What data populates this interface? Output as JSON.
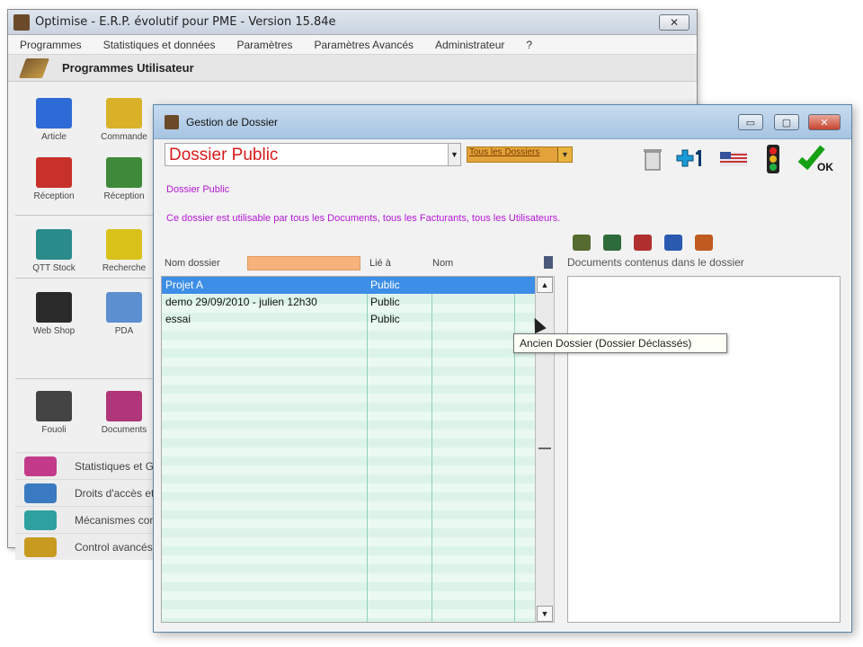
{
  "main_window": {
    "title": "Optimise  -  E.R.P. évolutif pour PME   -  Version 15.84e",
    "menu": [
      "Programmes",
      "Statistiques et données",
      "Paramètres",
      "Paramètres Avancés",
      "Administrateur",
      "?"
    ],
    "section_header": "Programmes Utilisateur",
    "tiles": [
      {
        "label": "Article",
        "color": "#2f6bd6"
      },
      {
        "label": "Commande",
        "color": "#d9b22a"
      },
      {
        "label": "Réception",
        "color": "#c8302a"
      },
      {
        "label": "Réception",
        "color": "#3f8a3a"
      },
      {
        "label": "QTT Stock",
        "color": "#2a8b8b"
      },
      {
        "label": "Recherche",
        "color": "#d8c21a"
      },
      {
        "label": "Web Shop",
        "color": "#2a2a2a"
      },
      {
        "label": "PDA",
        "color": "#5c8fd0"
      },
      {
        "label": "Fouoli",
        "color": "#444444"
      },
      {
        "label": "Documents",
        "color": "#b0367a"
      }
    ],
    "bottom_list": [
      {
        "label": "Statistiques et G",
        "color": "#c43a8a"
      },
      {
        "label": "Droits d'accès et",
        "color": "#3a7ac0"
      },
      {
        "label": "Mécanismes con",
        "color": "#2fa0a0"
      },
      {
        "label": "Control avancés",
        "color": "#c89a20"
      }
    ]
  },
  "dialog": {
    "title": "Gestion de Dossier",
    "buttons": {
      "minimize": "▭",
      "maximize": "▢",
      "close": "✕",
      "ok": "OK"
    },
    "dossier_select": "Dossier Public",
    "all_dossiers_select": "Tous les Dossiers",
    "info_name": "Dossier Public",
    "info_desc": "Ce dossier est utilisable par tous les Documents,  tous les Facturants, tous les Utilisateurs.",
    "columns": {
      "name": "Nom dossier",
      "linked": "Lié à",
      "nom": "Nom"
    },
    "docs_label": "Documents contenus dans le dossier",
    "rows": [
      {
        "name": "Projet A",
        "linked": "Public",
        "selected": true
      },
      {
        "name": "demo 29/09/2010 - julien 12h30",
        "linked": "Public",
        "selected": false
      },
      {
        "name": "essai",
        "linked": "Public",
        "selected": false
      }
    ],
    "tooltip": "Ancien Dossier (Dossier Déclassés)"
  },
  "colors": {
    "title_red": "#d81a1a",
    "info_magenta": "#b517d6",
    "selection_blue": "#3d8ee6",
    "grid_green": "#dcf4e8",
    "filter_orange": "#f6b27a"
  }
}
